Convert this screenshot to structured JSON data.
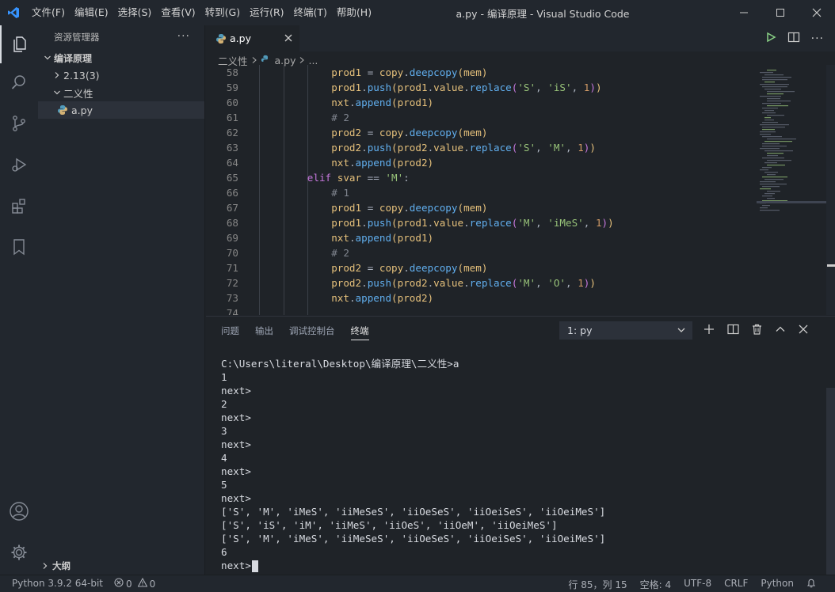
{
  "titlebar": {
    "menu": [
      "文件(F)",
      "编辑(E)",
      "选择(S)",
      "查看(V)",
      "转到(G)",
      "运行(R)",
      "终端(T)",
      "帮助(H)"
    ],
    "title": "a.py - 编译原理 - Visual Studio Code"
  },
  "sidebar": {
    "header": "资源管理器",
    "more": "···",
    "tree": [
      {
        "label": "编译原理",
        "level": 0,
        "expanded": true,
        "bold": true
      },
      {
        "label": "2.13(3)",
        "level": 1,
        "expanded": false
      },
      {
        "label": "二义性",
        "level": 1,
        "expanded": true
      },
      {
        "label": "a.py",
        "level": 2,
        "file": true,
        "selected": true
      }
    ],
    "outline": "大纲"
  },
  "editor": {
    "tab": "a.py",
    "breadcrumb": [
      "二义性",
      "a.py",
      "..."
    ]
  },
  "code_lines": [
    {
      "n": "58",
      "indent": 5,
      "parts": [
        [
          "v",
          "prod1"
        ],
        [
          "o",
          " = "
        ],
        [
          "v",
          "copy"
        ],
        [
          "o",
          "."
        ],
        [
          "f",
          "deepcopy"
        ],
        [
          "p",
          "("
        ],
        [
          "v",
          "mem"
        ],
        [
          "p",
          ")"
        ]
      ]
    },
    {
      "n": "59",
      "indent": 5,
      "parts": [
        [
          "v",
          "prod1"
        ],
        [
          "o",
          "."
        ],
        [
          "f",
          "push"
        ],
        [
          "p",
          "("
        ],
        [
          "v",
          "prod1"
        ],
        [
          "o",
          "."
        ],
        [
          "v",
          "value"
        ],
        [
          "o",
          "."
        ],
        [
          "f",
          "replace"
        ],
        [
          "p2",
          "("
        ],
        [
          "s",
          "'S'"
        ],
        [
          "o",
          ", "
        ],
        [
          "s",
          "'iS'"
        ],
        [
          "o",
          ", "
        ],
        [
          "n",
          "1"
        ],
        [
          "p2",
          ")"
        ],
        [
          "p",
          ")"
        ]
      ]
    },
    {
      "n": "60",
      "indent": 5,
      "parts": [
        [
          "v",
          "nxt"
        ],
        [
          "o",
          "."
        ],
        [
          "f",
          "append"
        ],
        [
          "p",
          "("
        ],
        [
          "v",
          "prod1"
        ],
        [
          "p",
          ")"
        ]
      ]
    },
    {
      "n": "61",
      "indent": 5,
      "parts": [
        [
          "c",
          "# 2"
        ]
      ]
    },
    {
      "n": "62",
      "indent": 5,
      "parts": [
        [
          "v",
          "prod2"
        ],
        [
          "o",
          " = "
        ],
        [
          "v",
          "copy"
        ],
        [
          "o",
          "."
        ],
        [
          "f",
          "deepcopy"
        ],
        [
          "p",
          "("
        ],
        [
          "v",
          "mem"
        ],
        [
          "p",
          ")"
        ]
      ]
    },
    {
      "n": "63",
      "indent": 5,
      "parts": [
        [
          "v",
          "prod2"
        ],
        [
          "o",
          "."
        ],
        [
          "f",
          "push"
        ],
        [
          "p",
          "("
        ],
        [
          "v",
          "prod2"
        ],
        [
          "o",
          "."
        ],
        [
          "v",
          "value"
        ],
        [
          "o",
          "."
        ],
        [
          "f",
          "replace"
        ],
        [
          "p2",
          "("
        ],
        [
          "s",
          "'S'"
        ],
        [
          "o",
          ", "
        ],
        [
          "s",
          "'M'"
        ],
        [
          "o",
          ", "
        ],
        [
          "n",
          "1"
        ],
        [
          "p2",
          ")"
        ],
        [
          "p",
          ")"
        ]
      ]
    },
    {
      "n": "64",
      "indent": 5,
      "parts": [
        [
          "v",
          "nxt"
        ],
        [
          "o",
          "."
        ],
        [
          "f",
          "append"
        ],
        [
          "p",
          "("
        ],
        [
          "v",
          "prod2"
        ],
        [
          "p",
          ")"
        ]
      ]
    },
    {
      "n": "65",
      "indent": 4,
      "parts": [
        [
          "k",
          "elif"
        ],
        [
          "o",
          " "
        ],
        [
          "v",
          "svar"
        ],
        [
          "o",
          " == "
        ],
        [
          "s",
          "'M'"
        ],
        [
          "o",
          ":"
        ]
      ]
    },
    {
      "n": "66",
      "indent": 5,
      "parts": [
        [
          "c",
          "# 1"
        ]
      ]
    },
    {
      "n": "67",
      "indent": 5,
      "parts": [
        [
          "v",
          "prod1"
        ],
        [
          "o",
          " = "
        ],
        [
          "v",
          "copy"
        ],
        [
          "o",
          "."
        ],
        [
          "f",
          "deepcopy"
        ],
        [
          "p",
          "("
        ],
        [
          "v",
          "mem"
        ],
        [
          "p",
          ")"
        ]
      ]
    },
    {
      "n": "68",
      "indent": 5,
      "parts": [
        [
          "v",
          "prod1"
        ],
        [
          "o",
          "."
        ],
        [
          "f",
          "push"
        ],
        [
          "p",
          "("
        ],
        [
          "v",
          "prod1"
        ],
        [
          "o",
          "."
        ],
        [
          "v",
          "value"
        ],
        [
          "o",
          "."
        ],
        [
          "f",
          "replace"
        ],
        [
          "p2",
          "("
        ],
        [
          "s",
          "'M'"
        ],
        [
          "o",
          ", "
        ],
        [
          "s",
          "'iMeS'"
        ],
        [
          "o",
          ", "
        ],
        [
          "n",
          "1"
        ],
        [
          "p2",
          ")"
        ],
        [
          "p",
          ")"
        ]
      ]
    },
    {
      "n": "69",
      "indent": 5,
      "parts": [
        [
          "v",
          "nxt"
        ],
        [
          "o",
          "."
        ],
        [
          "f",
          "append"
        ],
        [
          "p",
          "("
        ],
        [
          "v",
          "prod1"
        ],
        [
          "p",
          ")"
        ]
      ]
    },
    {
      "n": "70",
      "indent": 5,
      "parts": [
        [
          "c",
          "# 2"
        ]
      ]
    },
    {
      "n": "71",
      "indent": 5,
      "parts": [
        [
          "v",
          "prod2"
        ],
        [
          "o",
          " = "
        ],
        [
          "v",
          "copy"
        ],
        [
          "o",
          "."
        ],
        [
          "f",
          "deepcopy"
        ],
        [
          "p",
          "("
        ],
        [
          "v",
          "mem"
        ],
        [
          "p",
          ")"
        ]
      ]
    },
    {
      "n": "72",
      "indent": 5,
      "parts": [
        [
          "v",
          "prod2"
        ],
        [
          "o",
          "."
        ],
        [
          "f",
          "push"
        ],
        [
          "p",
          "("
        ],
        [
          "v",
          "prod2"
        ],
        [
          "o",
          "."
        ],
        [
          "v",
          "value"
        ],
        [
          "o",
          "."
        ],
        [
          "f",
          "replace"
        ],
        [
          "p2",
          "("
        ],
        [
          "s",
          "'M'"
        ],
        [
          "o",
          ", "
        ],
        [
          "s",
          "'O'"
        ],
        [
          "o",
          ", "
        ],
        [
          "n",
          "1"
        ],
        [
          "p2",
          ")"
        ],
        [
          "p",
          ")"
        ]
      ]
    },
    {
      "n": "73",
      "indent": 5,
      "parts": [
        [
          "v",
          "nxt"
        ],
        [
          "o",
          "."
        ],
        [
          "f",
          "append"
        ],
        [
          "p",
          "("
        ],
        [
          "v",
          "prod2"
        ],
        [
          "p",
          ")"
        ]
      ]
    },
    {
      "n": "74",
      "indent": 0,
      "parts": []
    }
  ],
  "panel": {
    "tabs": [
      "问题",
      "输出",
      "调试控制台",
      "终端"
    ],
    "active_tab": "终端",
    "terminal_select": "1: py",
    "terminal_lines": [
      "C:\\Users\\literal\\Desktop\\编译原理\\二义性>a",
      "1",
      "next>",
      "2",
      "next>",
      "3",
      "next>",
      "4",
      "next>",
      "5",
      "next>",
      "['S', 'M', 'iMeS', 'iiMeSeS', 'iiOeSeS', 'iiOeiSeS', 'iiOeiMeS']",
      "['S', 'iS', 'iM', 'iiMeS', 'iiOeS', 'iiOeM', 'iiOeiMeS']",
      "['S', 'M', 'iMeS', 'iiMeSeS', 'iiOeSeS', 'iiOeiSeS', 'iiOeiMeS']",
      "6",
      "next>"
    ]
  },
  "statusbar": {
    "python": "Python 3.9.2 64-bit",
    "errors": "0",
    "warnings": "0",
    "position": "行 85，列 15",
    "spaces": "空格: 4",
    "encoding": "UTF-8",
    "eol": "CRLF",
    "language": "Python"
  },
  "colors": {
    "background": "#1f2328",
    "sidebar": "#22272e",
    "accent_blue": "#3794ff",
    "run_green": "#89d185"
  }
}
